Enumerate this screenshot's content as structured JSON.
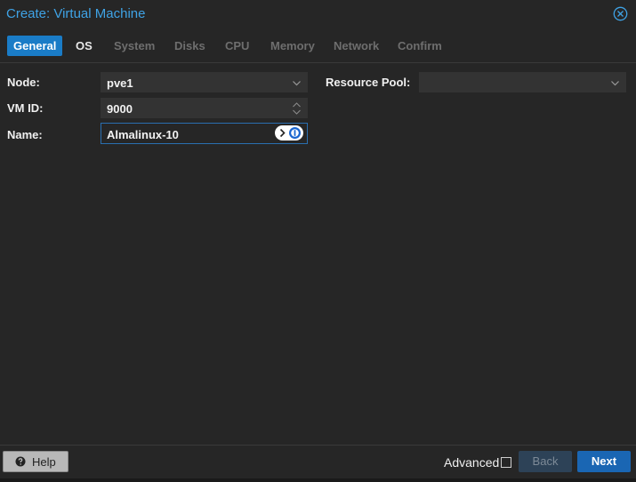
{
  "window": {
    "title": "Create: Virtual Machine",
    "close_icon": "close-circle-icon"
  },
  "tabs": [
    {
      "label": "General",
      "state": "active"
    },
    {
      "label": "OS",
      "state": "enabled"
    },
    {
      "label": "System",
      "state": "disabled"
    },
    {
      "label": "Disks",
      "state": "disabled"
    },
    {
      "label": "CPU",
      "state": "disabled"
    },
    {
      "label": "Memory",
      "state": "disabled"
    },
    {
      "label": "Network",
      "state": "disabled"
    },
    {
      "label": "Confirm",
      "state": "disabled"
    }
  ],
  "form": {
    "node": {
      "label": "Node:",
      "value": "pve1"
    },
    "vmid": {
      "label": "VM ID:",
      "value": "9000"
    },
    "name": {
      "label": "Name:",
      "value": "Almalinux-10"
    },
    "resource_pool": {
      "label": "Resource Pool:",
      "value": ""
    }
  },
  "footer": {
    "help_label": "Help",
    "advanced_label": "Advanced",
    "advanced_checked": false,
    "back_label": "Back",
    "next_label": "Next"
  },
  "colors": {
    "accent": "#1a7cc7",
    "title": "#3fa3e6",
    "background": "#262626"
  }
}
